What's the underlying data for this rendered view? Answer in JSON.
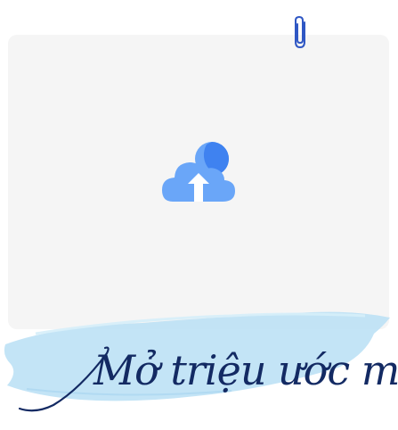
{
  "slogan": {
    "text": "Mở triệu ước mơ"
  },
  "colors": {
    "card_bg": "#f5f5f5",
    "icon_cloud": "#6aa6f8",
    "icon_sun": "#3f82f0",
    "brush": "#b8dff4",
    "slogan": "#132a63",
    "paperclip": "#2f57c4"
  },
  "icons": {
    "attach": "paperclip-icon",
    "upload": "cloud-upload-icon"
  }
}
